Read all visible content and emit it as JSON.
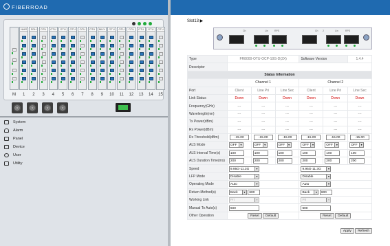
{
  "brand": {
    "name": "FIBERROAD"
  },
  "chassis": {
    "slot_headers": [
      "NMS",
      "SDH",
      "OTU",
      "OTU",
      "OTU",
      "OTU",
      "OTU",
      "OTU",
      "MUX",
      "OTU",
      "OTU",
      "OTU",
      "OTU",
      "OTU",
      "OTU"
    ],
    "slot_numbers": [
      "M",
      "1",
      "2",
      "3",
      "4",
      "5",
      "6",
      "7",
      "8",
      "9",
      "10",
      "11",
      "12",
      "13",
      "14",
      "15"
    ]
  },
  "menu": {
    "items": [
      {
        "label": "System",
        "icon": "monitor-icon"
      },
      {
        "label": "Alarm",
        "icon": "bell-icon"
      },
      {
        "label": "Panel",
        "icon": "panel-icon"
      },
      {
        "label": "Device",
        "icon": "device-icon"
      },
      {
        "label": "User",
        "icon": "user-icon"
      },
      {
        "label": "Utility",
        "icon": "utility-icon"
      }
    ]
  },
  "slot_title": "Slot13 ▶",
  "module": {
    "labels": [
      "Ch",
      "Lin",
      "RPS",
      "Ch",
      "2",
      "Lin",
      "RPS"
    ]
  },
  "rows": {
    "type": {
      "label": "Type",
      "value": "FR8000-OTU-OCP-10G-D(2X)",
      "sw_label": "Software Version",
      "sw_value": "1.4.4"
    },
    "description": {
      "label": "Descriptor",
      "value": ""
    },
    "status_title": "Status Information",
    "channel1": "Channel 1",
    "channel2": "Channel 2",
    "port": {
      "label": "Port",
      "values": [
        "Client",
        "Line Pri",
        "Line Sec",
        "Client",
        "Line Pri",
        "Line Sec"
      ]
    },
    "link_status": {
      "label": "Link Status",
      "values": [
        "Down",
        "Down",
        "Down",
        "Down",
        "Down",
        "Down"
      ]
    },
    "frequency": {
      "label": "Frequency(GHz)",
      "values": [
        "---",
        "---",
        "---",
        "---",
        "---",
        "---"
      ]
    },
    "wavelength": {
      "label": "Wavelength(nm)",
      "values": [
        "---",
        "---",
        "---",
        "---",
        "---",
        "---"
      ]
    },
    "tx_power": {
      "label": "Tx Power(dBm)",
      "values": [
        "---",
        "---",
        "---",
        "---",
        "---",
        "---"
      ]
    },
    "rx_power": {
      "label": "Rx Power(dBm)",
      "values": [
        "---",
        "---",
        "---",
        "---",
        "---",
        "---"
      ]
    },
    "rx_threshold": {
      "label": "Rx Threshold(dBm)",
      "values": [
        "-15.00",
        "-15.00",
        "-15.00",
        "-15.00",
        "-15.00",
        "-15.00"
      ]
    },
    "als_mode": {
      "label": "ALS Mode",
      "values": [
        "OFF",
        "OFF",
        "OFF",
        "OFF",
        "OFF",
        "OFF"
      ]
    },
    "als_interval": {
      "label": "ALS Interval Time(s)",
      "values": [
        "100",
        "100",
        "100",
        "100",
        "100",
        "100"
      ]
    },
    "als_duration": {
      "label": "ALS Duration Time(ms)",
      "values": [
        "200",
        "200",
        "200",
        "200",
        "200",
        "200"
      ]
    },
    "speed": {
      "label": "Speed",
      "values": [
        "9.95G-11.3G",
        "9.95G-11.3G"
      ]
    },
    "lfp_mode": {
      "label": "LFP Mode",
      "values": [
        "Disable",
        "Disable"
      ]
    },
    "operating_mode": {
      "label": "Operating Mode",
      "values": [
        "Auto",
        "Auto"
      ]
    },
    "return_method": {
      "label": "Return Method(s)",
      "values": [
        "Back",
        "Back"
      ],
      "times": [
        "600",
        "600"
      ]
    },
    "working_link": {
      "label": "Working Link",
      "values": [
        "Pri",
        "Pri"
      ]
    },
    "manual_to_auto": {
      "label": "Manual To Auto(s)",
      "values": [
        "600",
        "600"
      ]
    },
    "other_operation": {
      "label": "Other Operation",
      "reset": "Reset",
      "default": "Default"
    }
  },
  "actions": {
    "apply": "Apply",
    "refresh": "Refresh"
  },
  "colors": {
    "brand_blue": "#1f6ab0",
    "down_red": "#d10000",
    "led_green": "#1faa3a"
  }
}
